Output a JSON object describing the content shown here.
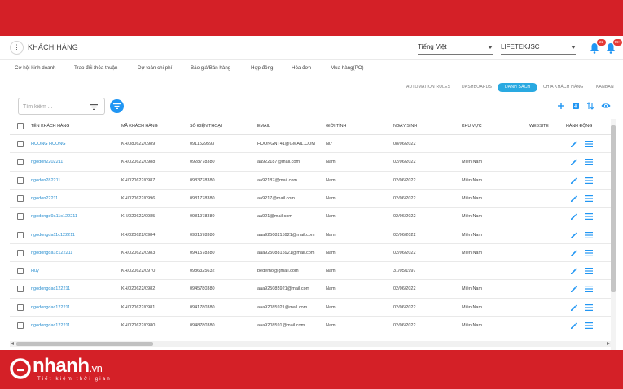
{
  "header": {
    "title": "KHÁCH HÀNG",
    "language": "Tiếng Việt",
    "company": "LIFETEKJSC",
    "notif_count_1": "22",
    "notif_count_2": "99+"
  },
  "module_tabs": [
    "Cơ hội kinh doanh",
    "Trao đổi thỏa thuận",
    "Dự toán chi phí",
    "Báo giá/Bán hàng",
    "Hợp đồng",
    "Hóa đơn",
    "Mua hàng(PO)"
  ],
  "view_tabs": [
    "AUTOMATION RULES",
    "DASHBOARDS",
    "DANH SÁCH",
    "CHIA KHÁCH HÀNG",
    "KANBAN"
  ],
  "active_view_tab": "DANH SÁCH",
  "search": {
    "placeholder": "Tìm kiếm ..."
  },
  "table": {
    "headers": [
      "TÊN KHÁCH HÀNG",
      "MÃ KHÁCH HÀNG",
      "SỐ ĐIỆN THOẠI",
      "EMAIL",
      "GIỚI TÍNH",
      "NGÀY SINH",
      "KHU VỰC",
      "WEBSITE",
      "HÀNH ĐỘNG"
    ],
    "rows": [
      [
        "HUONG HUONG",
        "KH/080622/0989",
        "0911529593",
        "HUONGNT41@GMAIL.COM",
        "Nữ",
        "08/06/2022",
        "",
        ""
      ],
      [
        "ngodon2202211",
        "KH/020622/0988",
        "0928778380",
        "aa922187@mail.com",
        "Nam",
        "02/06/2022",
        "Miền Nam",
        ""
      ],
      [
        "ngodon282211",
        "KH/020622/0987",
        "0983778380",
        "aa92187@mail.com",
        "Nam",
        "02/06/2022",
        "Miền Nam",
        ""
      ],
      [
        "ngodon22211",
        "KH/020622/0996",
        "0981778380",
        "aa9217@mail.com",
        "Nam",
        "02/06/2022",
        "Miền Nam",
        ""
      ],
      [
        "ngodongd9a11c122211",
        "KH/020622/0985",
        "0981978380",
        "aa921@mail.com",
        "Nam",
        "02/06/2022",
        "Miền Nam",
        ""
      ],
      [
        "ngodongda11c122211",
        "KH/020622/0984",
        "0981578380",
        "aaa92508215921@mail.com",
        "Nam",
        "02/06/2022",
        "Miền Nam",
        ""
      ],
      [
        "ngodongda1c122211",
        "KH/020622/0983",
        "0941578380",
        "aaa92508815921@mail.com",
        "Nam",
        "02/06/2022",
        "Miền Nam",
        ""
      ],
      [
        "Huy",
        "KH/020622/0970",
        "0986325632",
        "bedemo@gmail.com",
        "Nam",
        "31/05/1997",
        "",
        ""
      ],
      [
        "ngodongdac122211",
        "KH/020622/0982",
        "0945780380",
        "aaa925085921@mail.com",
        "Nam",
        "02/06/2022",
        "Miền Nam",
        ""
      ],
      [
        "ngodongdac122211",
        "KH/020622/0981",
        "0941780380",
        "aaa92085921@mail.com",
        "Nam",
        "02/06/2022",
        "Miền Nam",
        ""
      ],
      [
        "ngodongdac122211",
        "KH/020622/0980",
        "0948780380",
        "aaa9208591@mail.com",
        "Nam",
        "02/06/2022",
        "Miền Nam",
        ""
      ]
    ]
  },
  "logo": {
    "brand": "nhanh",
    "tld": ".vn",
    "tagline": "Tiết kiệm thời gian"
  },
  "colors": {
    "brand_red": "#d42027",
    "accent_blue": "#2196f3",
    "link_blue": "#2a8fd0",
    "tab_active": "#29a9e1"
  }
}
